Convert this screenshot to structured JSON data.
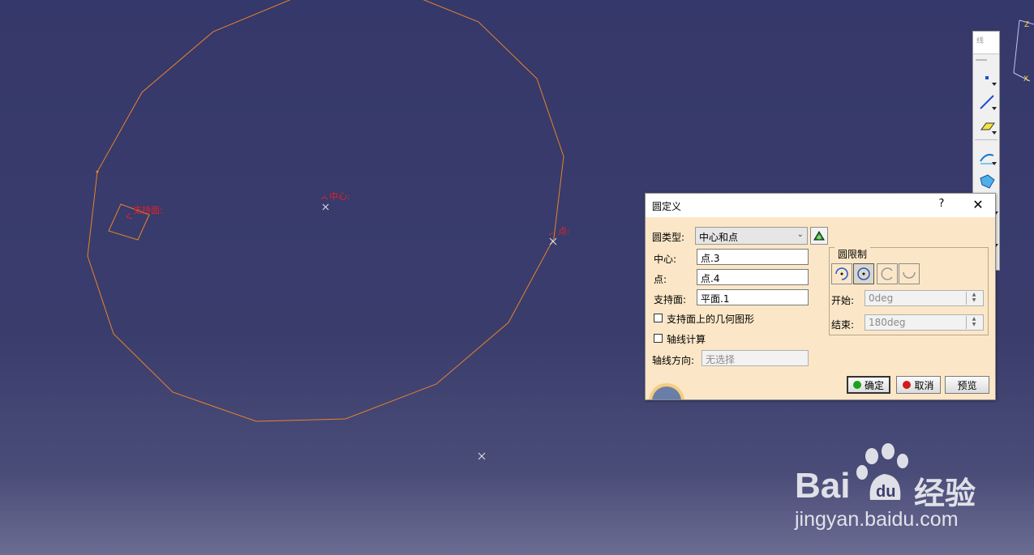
{
  "canvas": {
    "labels": {
      "support": "支持面:",
      "center": "中心:",
      "point": "点:"
    }
  },
  "toolbar": {
    "head": "线",
    "tools": [
      "point-icon",
      "line-icon",
      "plane-icon",
      "projection-icon",
      "intersection-icon"
    ]
  },
  "dialog": {
    "title": "圆定义",
    "help": "?",
    "close": "✕",
    "circle_type_label": "圆类型:",
    "circle_type_value": "中心和点",
    "center_label": "中心:",
    "center_value": "点.3",
    "point_label": "点:",
    "point_value": "点.4",
    "support_label": "支持面:",
    "support_value": "平面.1",
    "geometry_on_support": "支持面上的几何图形",
    "axis_compute": "轴线计算",
    "axis_direction_label": "轴线方向:",
    "axis_direction_placeholder": "无选择",
    "limits_legend": "圆限制",
    "start_label": "开始:",
    "start_value": "0deg",
    "end_label": "结束:",
    "end_value": "180deg",
    "ok": "确定",
    "cancel": "取消",
    "preview": "预览",
    "colors": {
      "ok_dot": "#1aa31a",
      "cancel_dot": "#d11b1b",
      "background": "#fbe7c7"
    }
  },
  "watermark": {
    "brand_left": "Bai",
    "brand_right": "经验",
    "url": "jingyan.baidu.com"
  }
}
